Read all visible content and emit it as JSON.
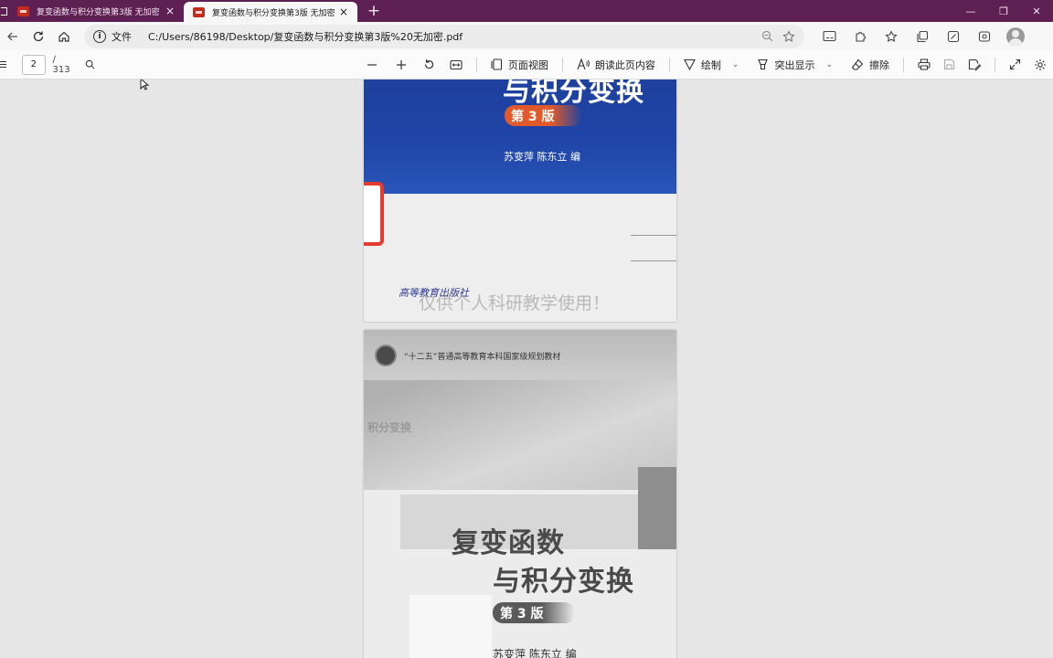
{
  "browser": {
    "tabs": [
      {
        "title": "复变函数与积分变换第3版 无加密",
        "state": "inactive"
      },
      {
        "title": "复变函数与积分变换第3版 无加密",
        "state": "active"
      }
    ],
    "new_tab_glyph": "+",
    "close_glyph": "×",
    "window_controls": {
      "minimize": "—",
      "restore": "❐",
      "close": "✕"
    },
    "address": {
      "scheme_label": "文件",
      "url": "C:/Users/86198/Desktop/复变函数与积分变换第3版%20无加密.pdf"
    }
  },
  "pdf_toolbar": {
    "page_current": "2",
    "page_total": "/ 313",
    "page_view_label": "页面视图",
    "read_aloud_label": "朗读此页内容",
    "draw_label": "绘制",
    "highlight_label": "突出显示",
    "erase_label": "擦除"
  },
  "document": {
    "page1": {
      "title": "与积分变换",
      "edition": "第 3 版",
      "authors": "苏变萍  陈东立  编",
      "publisher": "高等教育出版社",
      "watermark": "仅供个人科研教学使用！"
    },
    "page2": {
      "series": "“十二五”普通高等教育本科国家级规划教材",
      "ghost_text": "积分变换",
      "title_line1": "复变函数",
      "title_line2": "与积分变换",
      "edition": "第 3 版",
      "authors": "苏变萍  陈东立  编"
    }
  },
  "colors": {
    "tabstrip": "#5e1f53",
    "cover_blue": "#1f45a8",
    "edition_orange": "#e05a2b",
    "stamp_red": "#e33b2f"
  }
}
